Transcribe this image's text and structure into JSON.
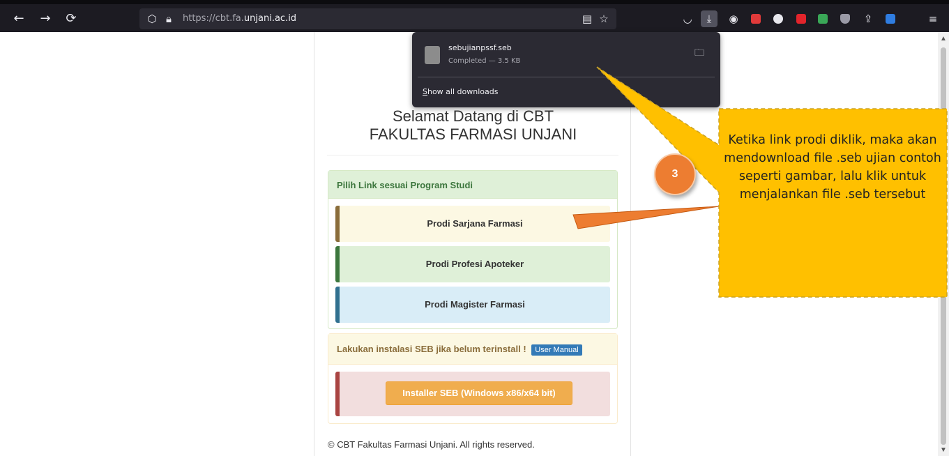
{
  "browser": {
    "url_prefix": "https://cbt.fa.",
    "url_domain": "unjani.ac.id"
  },
  "page": {
    "heading_line1": "Selamat Datang di CBT",
    "heading_line2": "FAKULTAS FARMASI UNJANI",
    "study_panel_title": "Pilih Link sesuai Program Studi",
    "programs": [
      {
        "label": "Prodi Sarjana Farmasi"
      },
      {
        "label": "Prodi Profesi Apoteker"
      },
      {
        "label": "Prodi Magister Farmasi"
      }
    ],
    "install_text": "Lakukan instalasi SEB jika belum terinstall !",
    "user_manual_label": "User Manual",
    "installer_label": "Installer SEB (Windows x86/x64 bit)",
    "footer": "© CBT Fakultas Farmasi Unjani. All rights reserved."
  },
  "downloads": {
    "file_name": "sebujianpssf.seb",
    "status": "Completed — 3.5 KB",
    "show_all_accesskey": "S",
    "show_all_rest": "how all downloads"
  },
  "annotation": {
    "step_number": "3",
    "callout_text": "Ketika link prodi diklik, maka akan mendownload file .seb ujian contoh seperti gambar, lalu klik untuk menjalankan file .seb tersebut"
  },
  "colors": {
    "callout_fill": "#ffc000",
    "badge_fill": "#ed7d31",
    "arrow_fill": "#ed7d31"
  },
  "icons": {
    "back": "back-arrow-icon",
    "forward": "forward-arrow-icon",
    "reload": "reload-icon",
    "download": "download-icon"
  }
}
